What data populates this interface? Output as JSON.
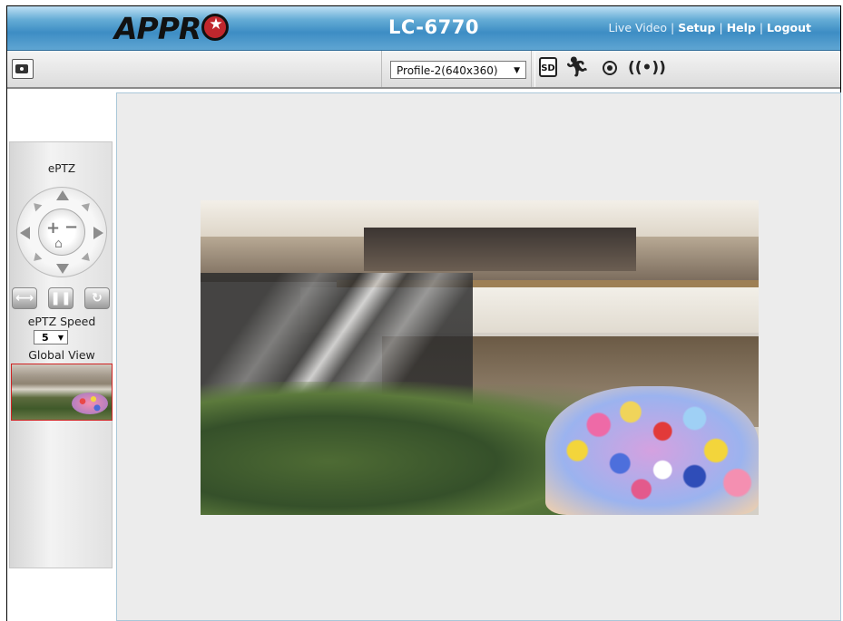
{
  "header": {
    "logo_text": "APPR",
    "model": "LC-6770",
    "links": {
      "live_video": "Live Video",
      "sep": " | ",
      "setup": "Setup",
      "help": "Help",
      "logout": "Logout"
    },
    "colors": {
      "bar": "#4a97c9",
      "model_text": "#ffffff"
    }
  },
  "toolbar": {
    "profile_select": "Profile-2(640x360)",
    "sd_label": "SD",
    "icons": [
      "camera-snapshot-icon",
      "sd-card-icon",
      "motion-running-icon",
      "record-icon",
      "alarm-light-icon"
    ]
  },
  "eptz": {
    "title": "ePTZ",
    "zoom_in": "+",
    "zoom_out": "−",
    "speed_label": "ePTZ Speed",
    "speed_value": "5",
    "global_view_label": "Global View"
  }
}
